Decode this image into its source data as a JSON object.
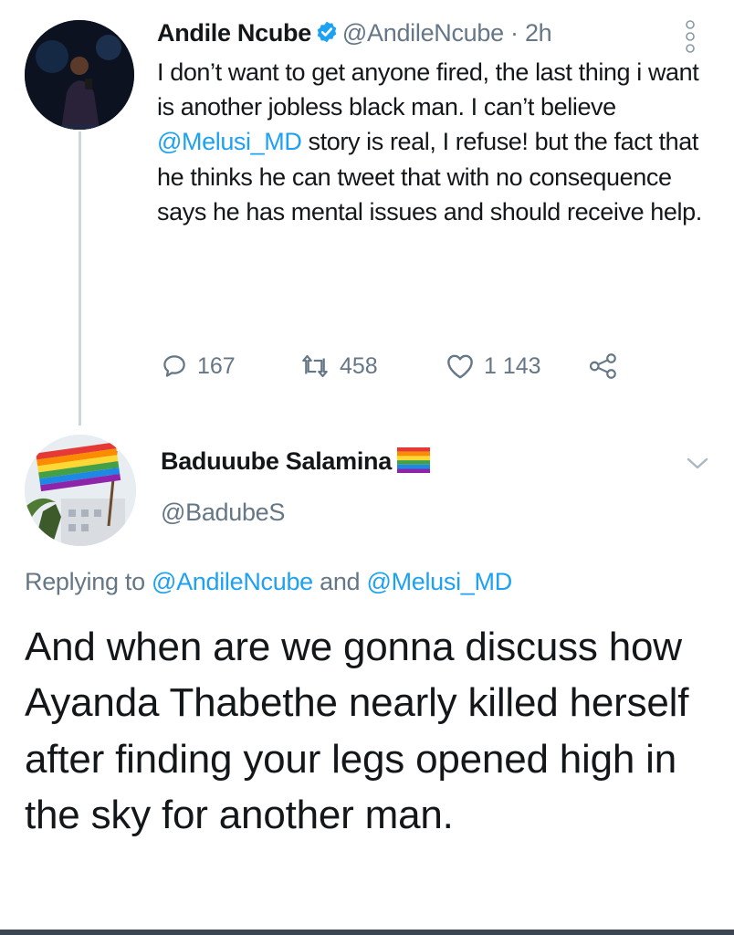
{
  "tweet": {
    "author_name": "Andile Ncube",
    "handle": "@AndileNcube",
    "separator": " · ",
    "time": "2h",
    "text_part1": "I don’t want to get anyone fired, the last thing i want is another jobless black man. I can’t believe ",
    "mention": "@Melusi_MD",
    "text_part2": " story is real, I refuse! but the fact that he thinks he can tweet that with no consequence says he has mental issues and should receive help.",
    "replies": "167",
    "retweets": "458",
    "likes": "1 143"
  },
  "reply": {
    "author_name": "Baduuube Salamina",
    "handle": "@BadubeS",
    "replying_prefix": "Replying to ",
    "replying_to_1": "@AndileNcube",
    "replying_and": " and ",
    "replying_to_2": "@Melusi_MD",
    "text": "And when are we gonna discuss how Ayanda Thabethe nearly killed herself after finding your legs opened high in the sky for another man."
  },
  "icons": {
    "verified": "verified-badge-icon",
    "reply": "speech-bubble-icon",
    "retweet": "retweet-icon",
    "like": "heart-icon",
    "share": "share-icon",
    "more": "more-dots-icon",
    "chevron": "chevron-down-icon",
    "flag": "rainbow-flag-icon"
  },
  "colors": {
    "link": "#1da1f2",
    "secondary_text": "#657786",
    "verified": "#1da1f2",
    "thread_line": "#ccd6dd"
  }
}
